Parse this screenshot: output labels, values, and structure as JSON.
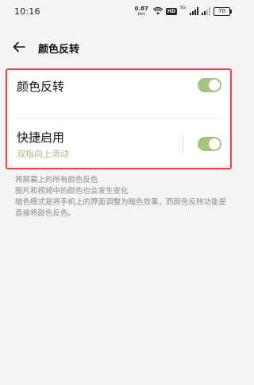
{
  "status_bar": {
    "time": "10:16",
    "net_speed_value": "0.87",
    "net_speed_unit": "KB/S",
    "hd_label": "HD",
    "signal_label": "5G",
    "battery": "70"
  },
  "header": {
    "title": "颜色反转"
  },
  "settings": {
    "invert_colors": {
      "label": "颜色反转",
      "enabled": true
    },
    "quick_enable": {
      "label": "快捷启用",
      "subtitle": "双指向上滑动",
      "enabled": true
    }
  },
  "description": {
    "lines": [
      "将屏幕上的所有颜色反色",
      "图片和视频中的颜色也会发生变化",
      "暗色模式是将手机上的界面调整为暗色效果，而颜色反转功能是直接将颜色反色。"
    ]
  },
  "colors": {
    "toggle_on": "#a4c47b",
    "highlight_outline": "#e8473c",
    "subtitle": "#a7c27f"
  },
  "icons": {
    "back": "arrow-left-icon",
    "wifi": "wifi-icon",
    "signal": "signal-icon",
    "battery": "battery-icon"
  }
}
